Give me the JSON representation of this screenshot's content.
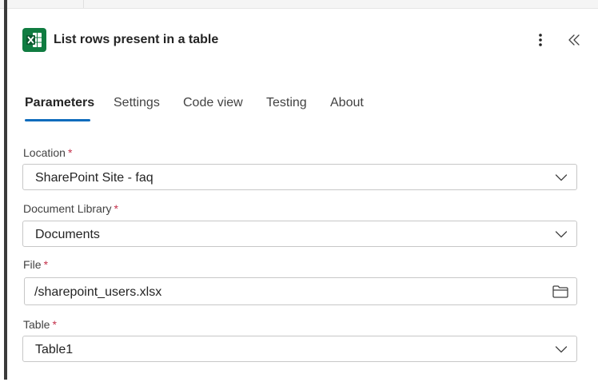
{
  "header": {
    "title": "List rows present in a table",
    "app_icon": "excel-icon",
    "more_icon": "more-vertical-icon",
    "collapse_icon": "double-chevron-left-icon"
  },
  "tabs": [
    {
      "label": "Parameters",
      "active": true
    },
    {
      "label": "Settings",
      "active": false
    },
    {
      "label": "Code view",
      "active": false
    },
    {
      "label": "Testing",
      "active": false
    },
    {
      "label": "About",
      "active": false
    }
  ],
  "fields": {
    "location": {
      "label": "Location",
      "required_mark": "*",
      "value": "SharePoint Site - faq"
    },
    "document_library": {
      "label": "Document Library",
      "required_mark": "*",
      "value": "Documents"
    },
    "file": {
      "label": "File",
      "required_mark": "*",
      "value": "/sharepoint_users.xlsx"
    },
    "table": {
      "label": "Table",
      "required_mark": "*",
      "value": "Table1"
    }
  },
  "colors": {
    "excel_green": "#107c41",
    "accent_blue": "#0f6cbd",
    "required_red": "#c4314b"
  }
}
